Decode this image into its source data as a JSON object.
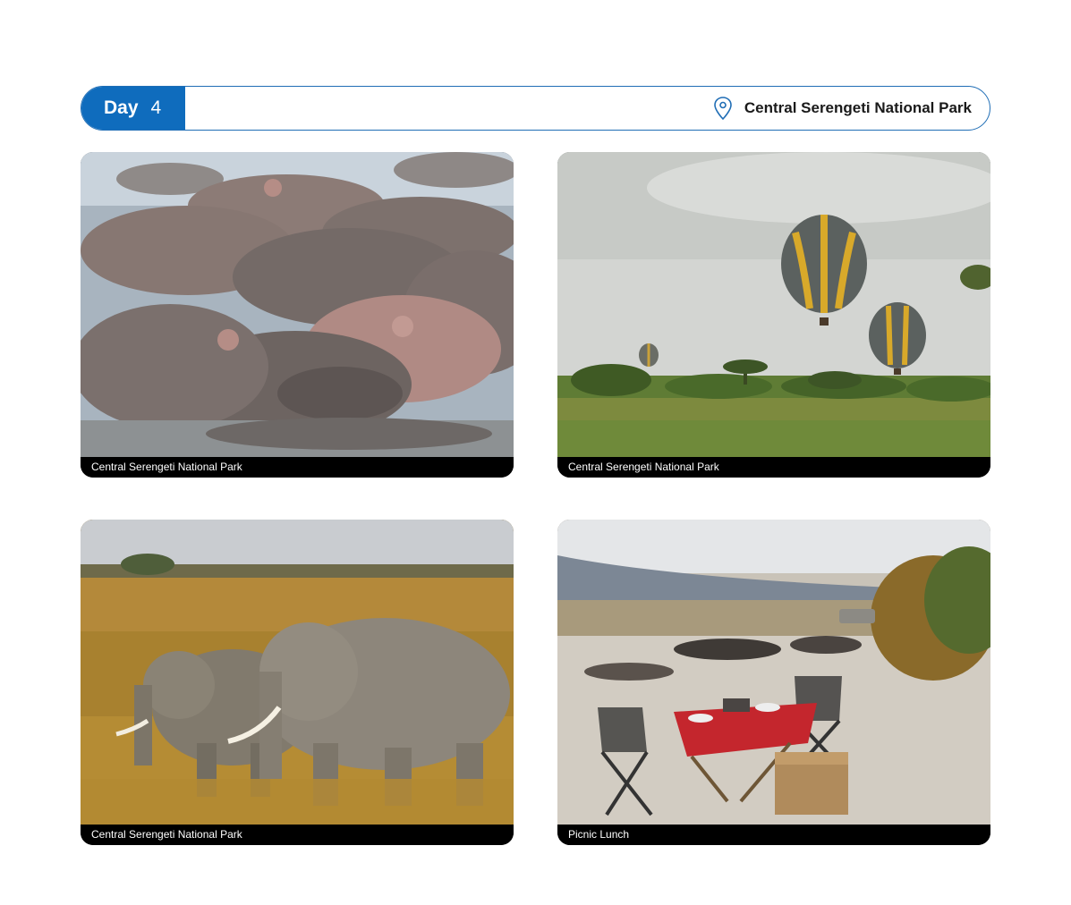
{
  "header": {
    "day_label": "Day",
    "day_number": "4",
    "location": "Central Serengeti National Park",
    "location_icon": "map-pin-icon",
    "accent_color": "#0f6cbd"
  },
  "cards": [
    {
      "caption": "Central Serengeti National Park",
      "subject": "hippos"
    },
    {
      "caption": "Central Serengeti National Park",
      "subject": "hot-air-balloons"
    },
    {
      "caption": "Central Serengeti National Park",
      "subject": "elephants"
    },
    {
      "caption": "Picnic Lunch",
      "subject": "picnic-table"
    }
  ]
}
